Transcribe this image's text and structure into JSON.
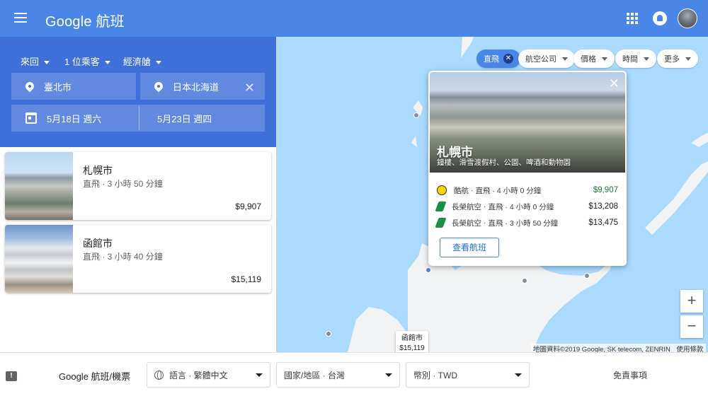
{
  "header": {
    "brand_google": "Google",
    "brand_product": "航班"
  },
  "search": {
    "trip_type": "來回",
    "passengers": "1 位乘客",
    "cabin": "經濟艙",
    "origin": "臺北市",
    "destination": "日本北海道",
    "depart_date": "5月18日 週六",
    "return_date": "5月23日 週四"
  },
  "results": [
    {
      "city": "札幌市",
      "info": "直飛 · 3 小時 50 分鐘",
      "price": "$9,907"
    },
    {
      "city": "函館市",
      "info": "直飛 · 3 小時 40 分鐘",
      "price": "$15,119"
    }
  ],
  "filters": {
    "nonstop": "直飛",
    "airlines": "航空公司",
    "price": "價格",
    "times": "時間",
    "more": "更多"
  },
  "popup": {
    "title": "札幌市",
    "subtitle": "鐘樓、滑雪渡假村、公園、啤酒和動物園",
    "flights": [
      {
        "airline": "酷航",
        "detail": "直飛 · 4 小時 0 分鐘",
        "price": "$9,907",
        "logo": "scoot-logo"
      },
      {
        "airline": "長榮航空",
        "detail": "直飛 · 4 小時 0 分鐘",
        "price": "$13,208",
        "logo": "eva-logo"
      },
      {
        "airline": "長榮航空",
        "detail": "直飛 · 3 小時 50 分鐘",
        "price": "$13,475",
        "logo": "eva-logo"
      }
    ],
    "view_button": "查看航班"
  },
  "map": {
    "label_city": "函館市",
    "label_price": "$15,119",
    "attribution": "地圖資料©2019 Google, SK telecom, ZENRIN",
    "terms": "使用條款",
    "zoom_in": "+",
    "zoom_out": "−"
  },
  "footer": {
    "brand": "Google 航班/機票",
    "language": "語言 · 繁體中文",
    "region": "國家/地區 · 台灣",
    "currency": "幣別 · TWD",
    "disclaimer": "免責事項"
  },
  "colors": {
    "header_blue": "#4a86e8",
    "panel_blue": "#3f6fd9",
    "low_price_green": "#188038",
    "water": "#aadaff",
    "land": "#f1f3f4"
  }
}
